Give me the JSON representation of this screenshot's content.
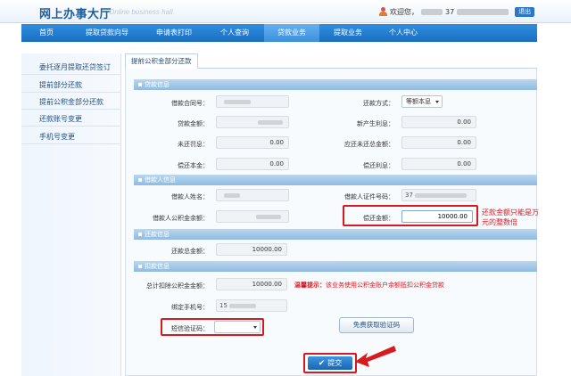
{
  "header": {
    "logo_text": "网上办事大厅",
    "logo_subtitle": "Online business hall",
    "welcome_label": "欢迎您，",
    "user_id_prefix": "37",
    "logout_label": "退出"
  },
  "nav": {
    "items": [
      {
        "label": "首页",
        "active": false
      },
      {
        "label": "提取贷款向导",
        "active": false
      },
      {
        "label": "申请表打印",
        "active": false
      },
      {
        "label": "个人查询",
        "active": false
      },
      {
        "label": "贷款业务",
        "active": true
      },
      {
        "label": "提取业务",
        "active": false
      },
      {
        "label": "个人中心",
        "active": false
      }
    ]
  },
  "sidebar": {
    "items": [
      {
        "label": "委托逐月提取还贷签订"
      },
      {
        "label": "提前部分还款"
      },
      {
        "label": "提前公积金部分还款"
      },
      {
        "label": "还款账号变更"
      },
      {
        "label": "手机号变更"
      }
    ]
  },
  "tab": {
    "label": "提前公积金部分还款"
  },
  "loan_info": {
    "section_title": "贷款信息",
    "contract_label": "借款合同号：",
    "repay_method_label": "还款方式：",
    "repay_method_value": "等额本息",
    "loan_amount_label": "贷款金额：",
    "new_interest_label": "新产生利息：",
    "new_interest_value": "0.00",
    "unpaid_penalty_label": "未还罚息：",
    "unpaid_penalty_value": "0.00",
    "due_total_label": "应还未还总金额：",
    "due_total_value": "0.00",
    "repay_principal_label": "偿还本金：",
    "repay_principal_value": "0.00",
    "repay_interest_label": "偿还利息：",
    "repay_interest_value": "0.00"
  },
  "borrower_info": {
    "section_title": "借款人信息",
    "name_label": "借款人姓名：",
    "id_label": "借款人证件号码：",
    "id_prefix": "37",
    "balance_label": "借款人公积金余额：",
    "repay_amount_label": "偿还金额：",
    "repay_amount_value": "10000.00",
    "repay_note": "还款金额只能是万元的整数倍"
  },
  "repay_info": {
    "section_title": "还款信息",
    "total_label": "还款总金额：",
    "total_value": "10000.00"
  },
  "deduct_info": {
    "section_title": "扣款信息",
    "total_deduct_label": "总计扣除公积金金额：",
    "total_deduct_value": "10000.00",
    "warning_prefix": "温馨提示：",
    "warning_text": "该业务使用公积金账户余额抵扣公积金贷款",
    "phone_label": "绑定手机号：",
    "phone_prefix": "15",
    "sms_label": "短信验证码：",
    "sms_value": "",
    "get_code_label": "免费获取验证码"
  },
  "submit": {
    "label": "提交",
    "check_icon": "✔"
  },
  "colors": {
    "nav_bg": "#1a6ec0",
    "section_bar": "#8fbbe2",
    "highlight_red": "#d71920",
    "submit_bg": "#1766b5"
  }
}
